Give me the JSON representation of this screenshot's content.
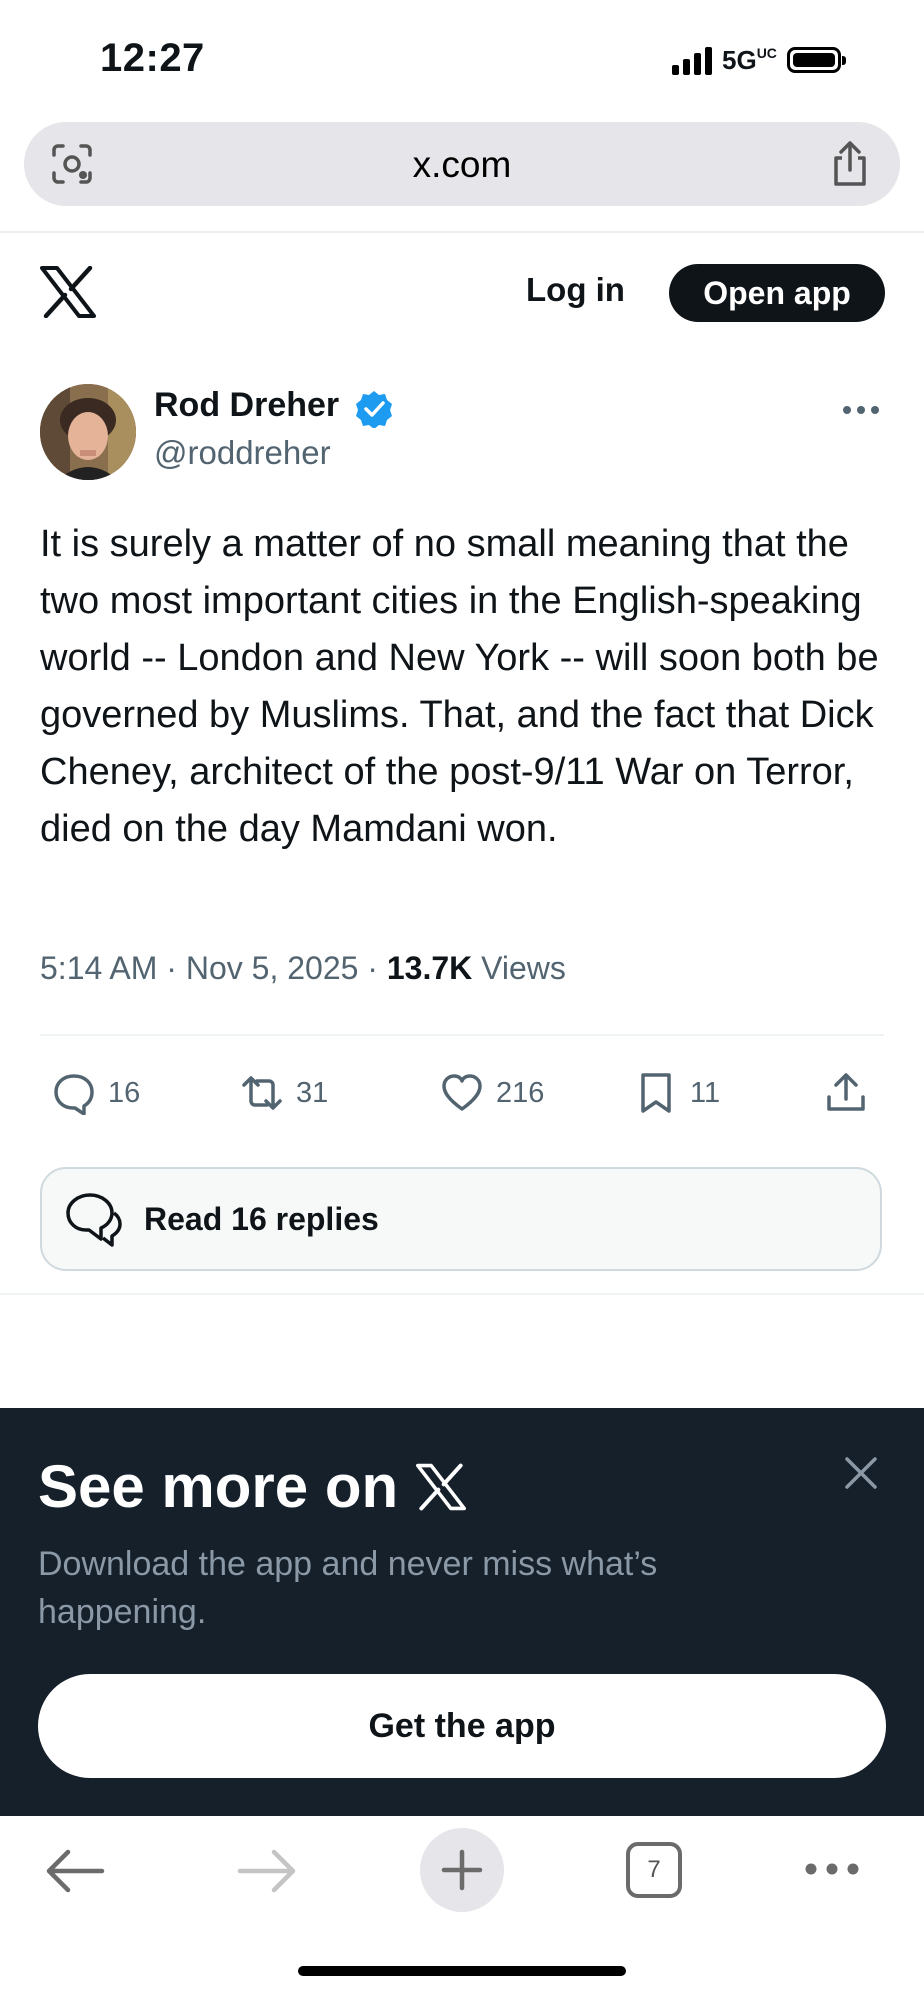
{
  "status_bar": {
    "time": "12:27",
    "network": "5G",
    "network_suffix": "UC"
  },
  "browser": {
    "url": "x.com",
    "tab_count": "7"
  },
  "header": {
    "login_label": "Log in",
    "open_app_label": "Open app"
  },
  "tweet": {
    "author_name": "Rod Dreher",
    "author_handle": "@roddreher",
    "text": "It is surely a matter of no small meaning that the two most important cities in the English-speaking world -- London and New York -- will soon both be governed by Muslims. That, and the fact that Dick Cheney, architect of the post-9/11 War on Terror, died on the day Mamdani won.",
    "time": "5:14 AM",
    "date": "Nov 5, 2025",
    "views_count": "13.7K",
    "views_label": "Views",
    "replies": "16",
    "reposts": "31",
    "likes": "216",
    "bookmarks": "11",
    "read_replies_label": "Read 16 replies"
  },
  "banner": {
    "title": "See more on",
    "subtitle": "Download the app and never miss what’s happening.",
    "cta_label": "Get the app"
  },
  "colors": {
    "text_primary": "#0f1419",
    "text_secondary": "#536471",
    "verified_blue": "#1d9bf0",
    "banner_bg": "#15202b"
  }
}
